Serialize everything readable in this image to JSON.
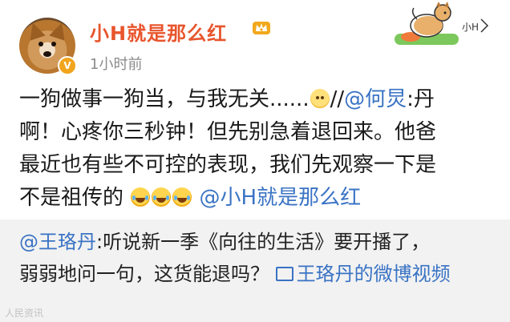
{
  "header": {
    "username": "小H就是那么红",
    "time": "1小时前",
    "verified_badge": "V"
  },
  "post": {
    "line1_a": "一狗做事一狗当，与我无关......",
    "line1_b": "//",
    "mention_1": "@何炅",
    "line1_c": ":丹",
    "line2": "啊！心疼你三秒钟！但先别急着退回来。他爸",
    "line3": "最近也有些不可控的表现，我们先观察一下是",
    "line4_a": "不是祖传的",
    "mention_2": "@小H就是那么红"
  },
  "repost": {
    "mention": "@王珞丹",
    "text_1": ":听说新一季《向往的生活》要开播了，",
    "text_2": "弱弱地问一句，这货能退吗？",
    "video_link": "王珞丹的微博视频"
  },
  "sticker": {
    "label": "小H"
  },
  "watermark": {
    "text": "人民资讯"
  },
  "colors": {
    "username": "#e8552d",
    "link": "#3a73c4",
    "repost_bg": "#f2f2f2"
  },
  "icons": [
    "avatar-dog",
    "verified-badge-icon",
    "crown-icon",
    "dog-sticker-icon",
    "sad-emoji-icon",
    "laugh-cry-emoji-icon",
    "video-icon"
  ]
}
